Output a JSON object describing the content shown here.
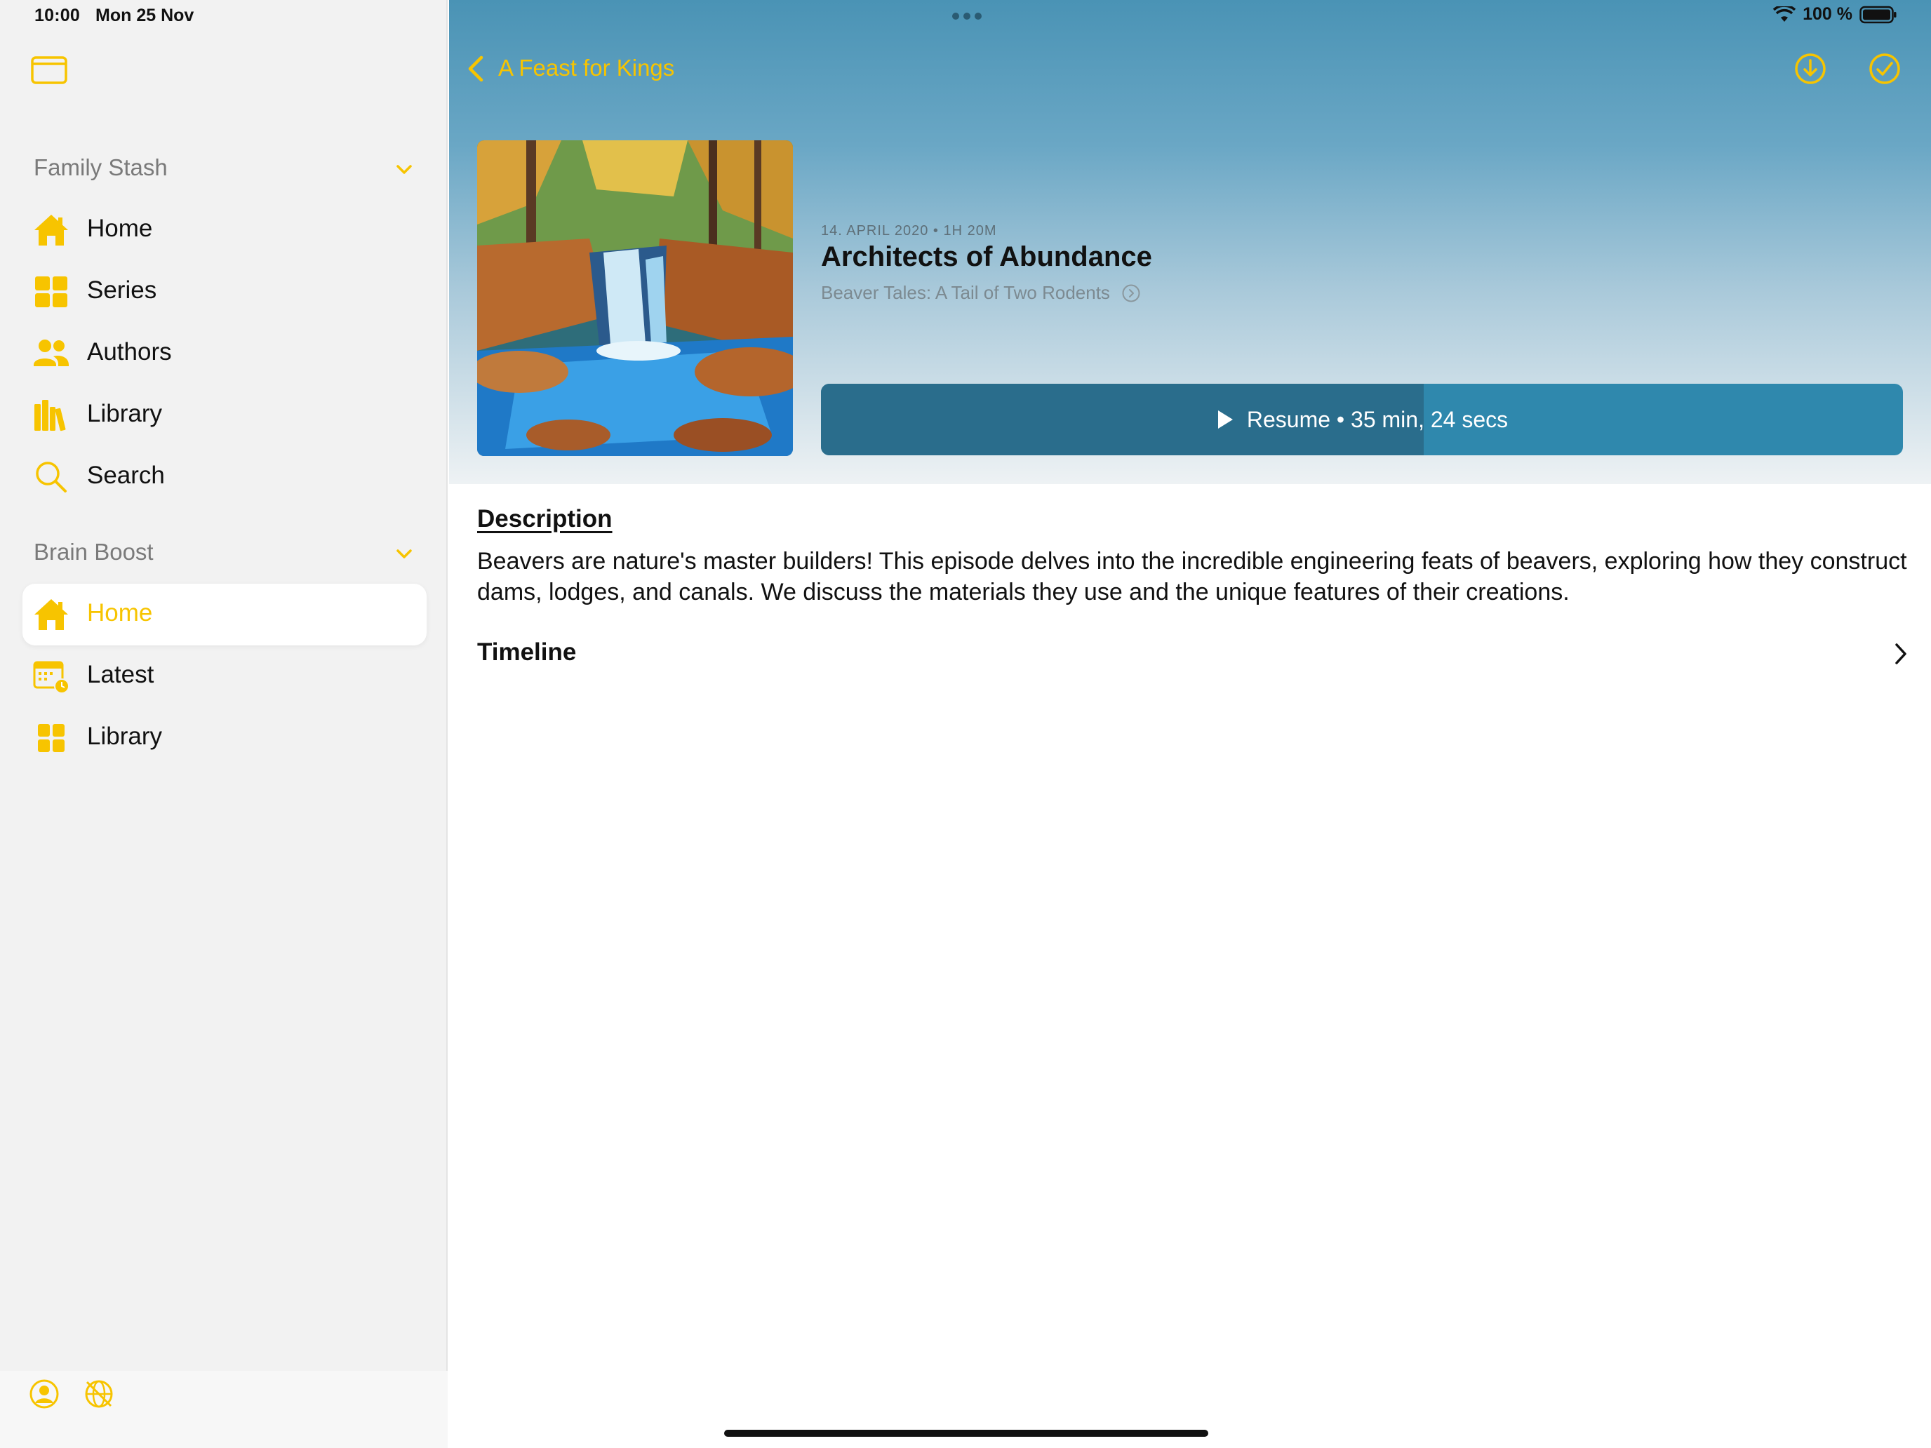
{
  "status_bar": {
    "time": "10:00",
    "date": "Mon 25 Nov",
    "battery": "100 %"
  },
  "sidebar": {
    "sections": [
      {
        "title": "Family Stash",
        "items": [
          {
            "label": "Home",
            "icon": "house-icon"
          },
          {
            "label": "Series",
            "icon": "grid-icon"
          },
          {
            "label": "Authors",
            "icon": "people-icon"
          },
          {
            "label": "Library",
            "icon": "books-icon"
          },
          {
            "label": "Search",
            "icon": "search-icon"
          }
        ]
      },
      {
        "title": "Brain Boost",
        "items": [
          {
            "label": "Home",
            "icon": "house-icon",
            "selected": true
          },
          {
            "label": "Latest",
            "icon": "calendar-clock-icon"
          },
          {
            "label": "Library",
            "icon": "grid-icon"
          }
        ]
      }
    ]
  },
  "nav": {
    "back_label": "A Feast for Kings"
  },
  "episode": {
    "meta": "14. APRIL 2020 • 1H 20M",
    "title": "Architects of Abundance",
    "series": "Beaver Tales: A Tail of Two Rodents",
    "resume_label": "Resume • 35 min, 24 secs",
    "progress": 0.557
  },
  "description": {
    "heading": "Description",
    "text": "Beavers are nature's master builders! This episode delves into the incredible engineering feats of beavers, exploring how they construct dams, lodges, and canals. We discuss the materials they use and the unique features of their creations."
  },
  "timeline": {
    "label": "Timeline"
  },
  "colors": {
    "accent": "#f7c400",
    "play_button": "#2f88ad",
    "play_progress": "#2a6d8c"
  }
}
